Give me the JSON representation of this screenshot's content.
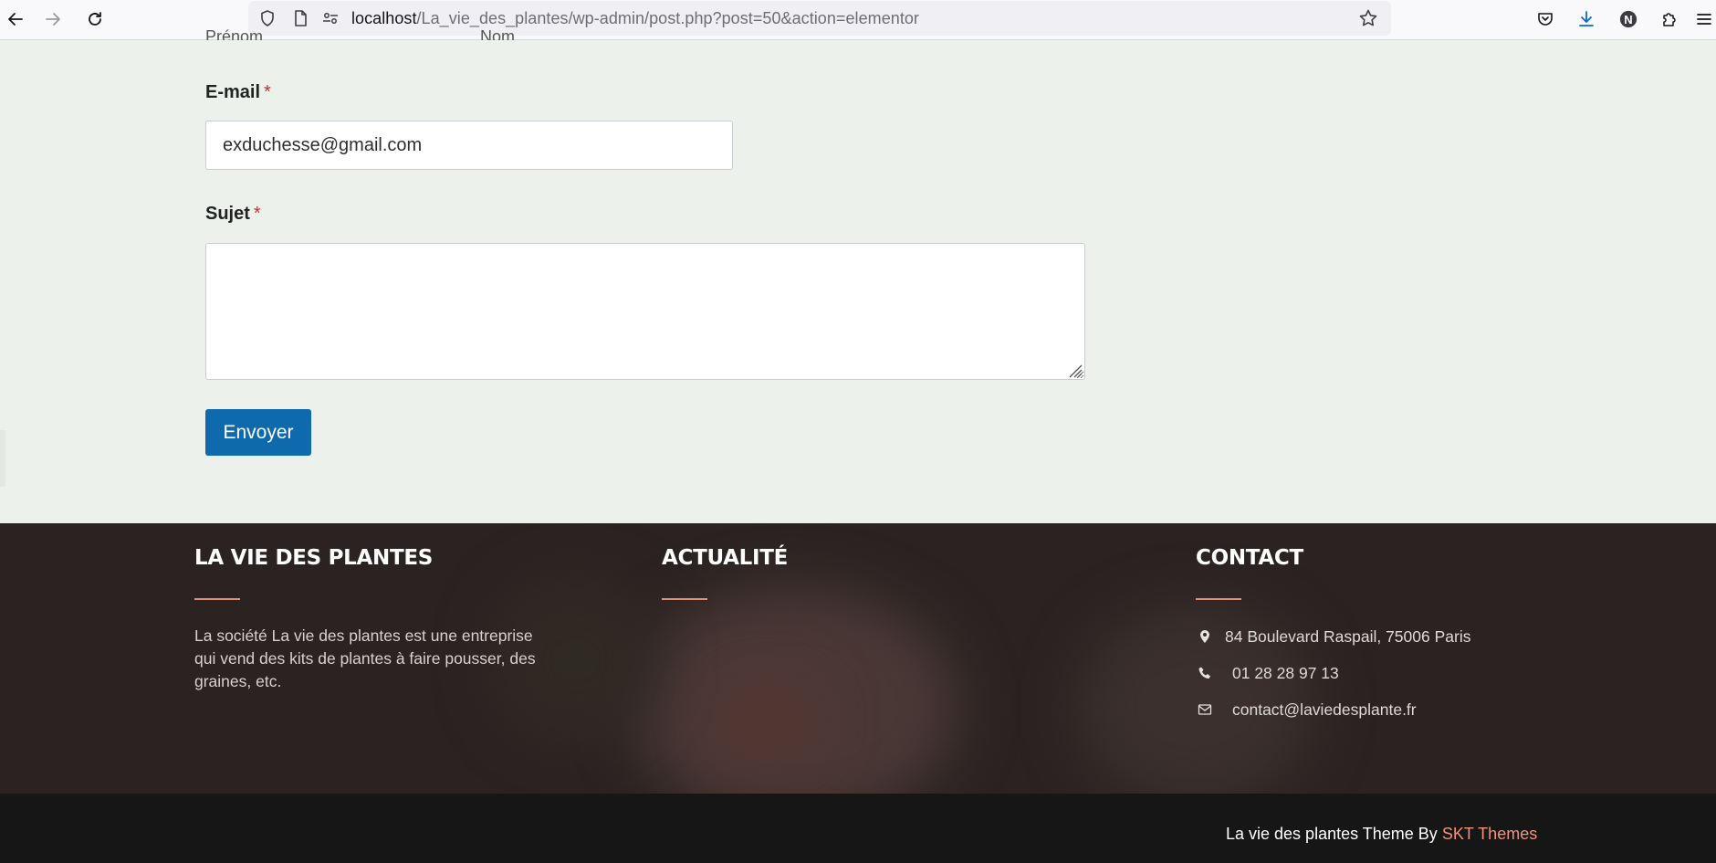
{
  "browser": {
    "url_host": "localhost",
    "url_path": "/La_vie_des_plantes/wp-admin/post.php?post=50&action=elementor",
    "profile_initial": "N"
  },
  "form": {
    "cut_labels": [
      "Prénom",
      "Nom"
    ],
    "email": {
      "label": "E-mail",
      "required_mark": "*",
      "value": "exduchesse@gmail.com"
    },
    "subject": {
      "label": "Sujet",
      "required_mark": "*",
      "value": ""
    },
    "submit_label": "Envoyer"
  },
  "footer": {
    "about": {
      "title": "LA VIE DES PLANTES",
      "text": "La société La vie des plantes est une entreprise qui vend des kits de plantes à faire pousser, des graines, etc."
    },
    "news": {
      "title": "ACTUALITÉ"
    },
    "contact": {
      "title": "CONTACT",
      "address": "84 Boulevard Raspail, 75006 Paris",
      "phone": "01 28 28 97 13",
      "email": "contact@laviedesplante.fr"
    },
    "credits": {
      "text": "La vie des plantes Theme By",
      "link": "SKT Themes"
    }
  },
  "colors": {
    "accent": "#e3907a",
    "button": "#0e6aac",
    "page_bg": "#ecf1ec",
    "footer_bg": "#2b2322",
    "bottom_bar": "#161616"
  }
}
